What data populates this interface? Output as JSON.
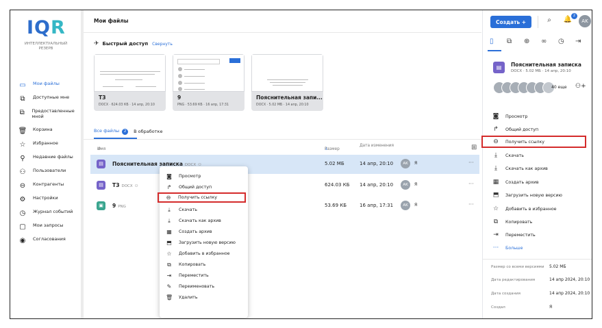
{
  "brand": {
    "logo_text_a": "IQ",
    "logo_text_b": "R",
    "subtitle": "ИНТЕЛЛЕКТУАЛЬНЫЙ РЕЗЕРВ"
  },
  "sidebar": {
    "items": [
      {
        "label": "Мои файлы",
        "icon": "folder-icon",
        "active": true
      },
      {
        "label": "Доступные мне",
        "icon": "shared-in-icon"
      },
      {
        "label": "Предоставленные мной",
        "icon": "shared-out-icon"
      },
      {
        "label": "Корзина",
        "icon": "trash-icon"
      },
      {
        "label": "Избранное",
        "icon": "star-icon"
      },
      {
        "label": "Недавние файлы",
        "icon": "pin-icon"
      },
      {
        "label": "Пользователи",
        "icon": "users-icon"
      },
      {
        "label": "Контрагенты",
        "icon": "contractors-icon"
      },
      {
        "label": "Настройки",
        "icon": "settings-icon"
      },
      {
        "label": "Журнал событий",
        "icon": "clock-icon"
      },
      {
        "label": "Мои запросы",
        "icon": "requests-icon"
      },
      {
        "label": "Согласования",
        "icon": "approval-icon"
      }
    ]
  },
  "header": {
    "title": "Мои файлы",
    "create_label": "Создать +",
    "bell_count": "2",
    "avatar": "AK"
  },
  "quick_access": {
    "title": "Быстрый доступ",
    "collapse_label": "Свернуть",
    "cards": [
      {
        "name": "ТЗ",
        "meta": "DOCX · 624.03 КБ · 14 апр, 20:10"
      },
      {
        "name": "9",
        "meta": "PNG · 53.69 КБ · 16 апр, 17:31"
      },
      {
        "name": "Пояснительная запи...",
        "meta": "DOCX · 5.02 МБ · 14 апр, 20:10"
      }
    ]
  },
  "tabs": {
    "all_label": "Все файлы",
    "all_count": "2",
    "processing_label": "В обработке"
  },
  "table": {
    "columns": {
      "name": "Имя",
      "size": "Размер",
      "date": "Дата изменения"
    },
    "rows": [
      {
        "name": "Пояснительная записка",
        "ext": "DOCX",
        "size": "5.02 МБ",
        "date": "14 апр, 20:10",
        "avatar": "AK",
        "owner": "Я",
        "selected": true,
        "color": "#7563c9"
      },
      {
        "name": "ТЗ",
        "ext": "DOCX",
        "size": "624.03 КБ",
        "date": "14 апр, 20:10",
        "avatar": "AK",
        "owner": "Я",
        "selected": false,
        "color": "#7563c9"
      },
      {
        "name": "9",
        "ext": "PNG",
        "size": "53.69 КБ",
        "date": "16 апр, 17:31",
        "avatar": "AK",
        "owner": "Я",
        "selected": false,
        "color": "#3aa58f"
      }
    ]
  },
  "context_menu": {
    "items": [
      {
        "label": "Просмотр",
        "icon": "view-icon"
      },
      {
        "label": "Общий доступ",
        "icon": "share-icon"
      },
      {
        "label": "Получить ссылку",
        "icon": "link-icon",
        "highlight": true
      },
      {
        "label": "Скачать",
        "icon": "download-icon"
      },
      {
        "label": "Скачать как архив",
        "icon": "download-archive-icon"
      },
      {
        "label": "Создать архив",
        "icon": "archive-icon"
      },
      {
        "label": "Загрузить новую версию",
        "icon": "upload-version-icon"
      },
      {
        "label": "Добавить в избранное",
        "icon": "star-icon"
      },
      {
        "label": "Копировать",
        "icon": "copy-icon"
      },
      {
        "label": "Переместить",
        "icon": "move-icon"
      },
      {
        "label": "Переименовать",
        "icon": "rename-icon"
      },
      {
        "label": "Удалить",
        "icon": "delete-icon"
      }
    ]
  },
  "right_panel": {
    "file_name": "Пояснительная записка",
    "file_meta": "DOCX · 5.02 МБ · 14 апр, 20:10",
    "more_users": "40 еще",
    "actions": [
      {
        "label": "Просмотр",
        "icon": "view-icon"
      },
      {
        "label": "Общий доступ",
        "icon": "share-icon"
      },
      {
        "label": "Получить ссылку",
        "icon": "link-icon",
        "highlight": true
      },
      {
        "label": "Скачать",
        "icon": "download-icon"
      },
      {
        "label": "Скачать как архив",
        "icon": "download-archive-icon"
      },
      {
        "label": "Создать архив",
        "icon": "archive-icon"
      },
      {
        "label": "Загрузить новую версию",
        "icon": "upload-version-icon"
      },
      {
        "label": "Добавить в избранное",
        "icon": "star-icon"
      },
      {
        "label": "Копировать",
        "icon": "copy-icon"
      },
      {
        "label": "Переместить",
        "icon": "move-icon"
      },
      {
        "label": "Больше",
        "icon": "more-icon",
        "blue": true
      }
    ],
    "properties": [
      {
        "label": "Размер со всеми версиями",
        "value": "5.02 МБ"
      },
      {
        "label": "Дата редактирования",
        "value": "14 апр 2024, 20:10"
      },
      {
        "label": "Дата создания",
        "value": "14 апр 2024, 20:10"
      },
      {
        "label": "Создал",
        "value": "Я"
      }
    ]
  }
}
